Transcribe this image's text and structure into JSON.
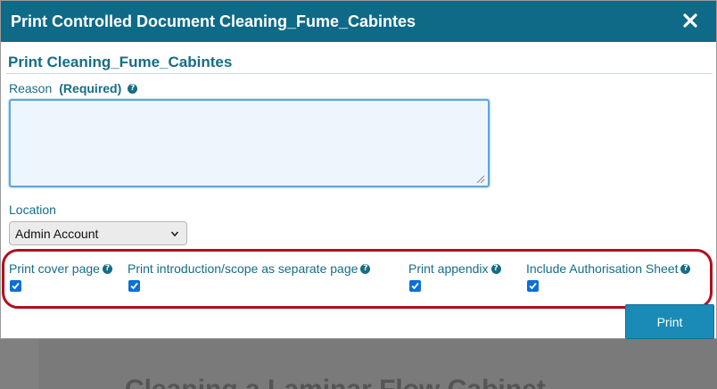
{
  "dialog": {
    "title": "Print Controlled Document Cleaning_Fume_Cabintes",
    "close_icon": "close-icon"
  },
  "form": {
    "section_title": "Print Cleaning_Fume_Cabintes",
    "reason": {
      "label": "Reason",
      "required_label": "(Required)",
      "value": "",
      "help_icon": "question-circle-icon"
    },
    "location": {
      "label": "Location",
      "selected": "Admin Account"
    },
    "options": [
      {
        "label": "Print cover page",
        "checked": true
      },
      {
        "label": "Print introduction/scope as separate page",
        "checked": true
      },
      {
        "label": "Print appendix",
        "checked": true
      },
      {
        "label": "Include Authorisation Sheet",
        "checked": true
      }
    ],
    "print_button": "Print"
  },
  "background": {
    "heading_fragment": "Cleaning a Laminar Flow Cabinet"
  },
  "colors": {
    "header_bg": "#0e6a87",
    "accent_text": "#156d86",
    "button_bg": "#1a8bb6",
    "highlight_border": "#b0101e",
    "checkbox": "#0b6fd6"
  }
}
